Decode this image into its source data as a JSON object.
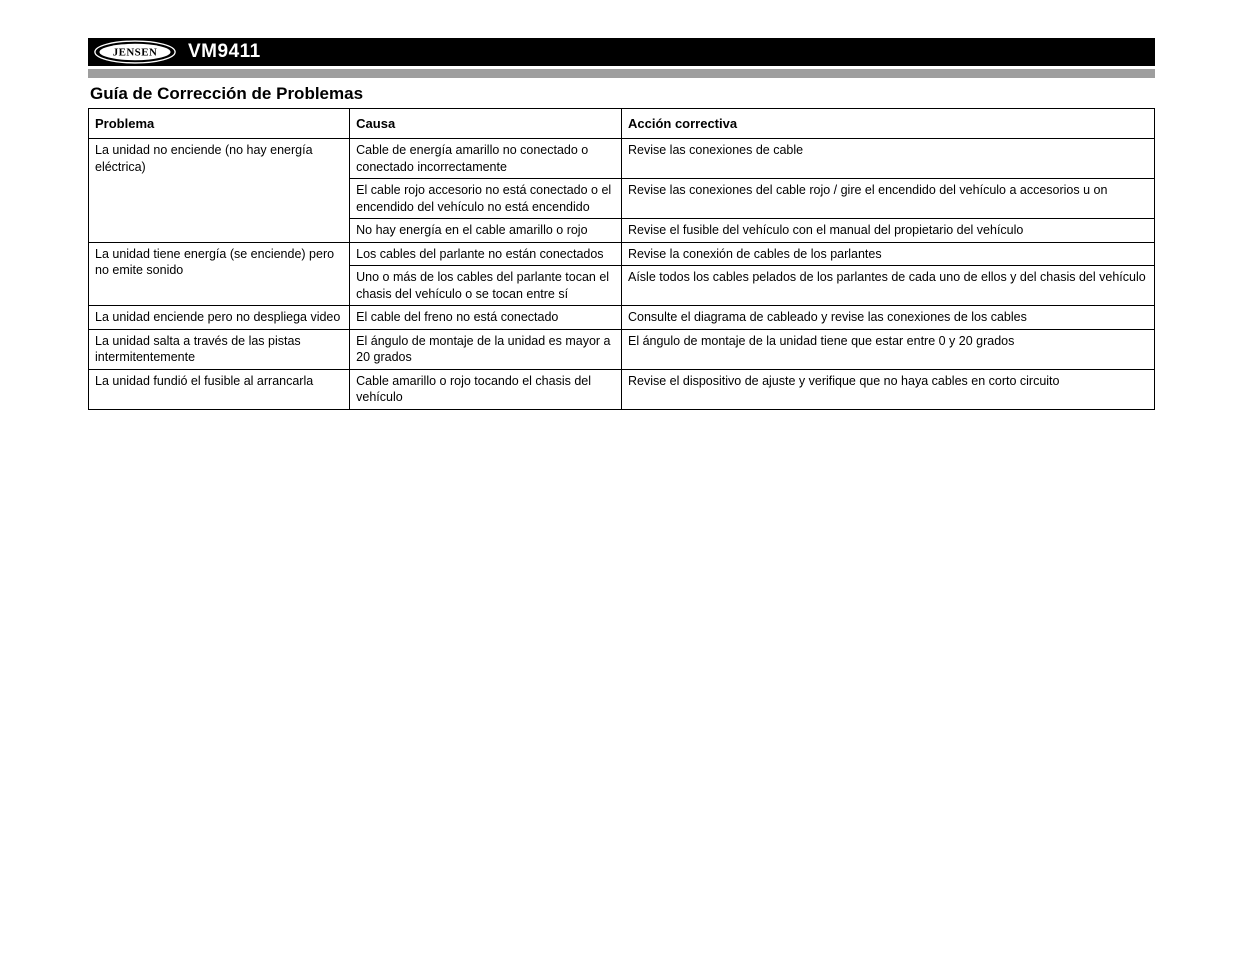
{
  "header": {
    "brand": "JENSEN",
    "model": "VM9411"
  },
  "section_title": "Guía de Corrección de Problemas",
  "columns": {
    "problem": "Problema",
    "cause": "Causa",
    "action": "Acción correctiva"
  },
  "rows": [
    {
      "problem": "La unidad no enciende (no hay energía eléctrica)",
      "entries": [
        {
          "cause": "Cable de energía amarillo no conectado o conectado incorrectamente",
          "action": "Revise las conexiones de cable"
        },
        {
          "cause": "El cable rojo accesorio no está conectado o el encendido del vehículo no está encendido",
          "action": "Revise las conexiones del cable rojo / gire el encendido del vehículo a accesorios u on"
        },
        {
          "cause": "No hay energía en el cable amarillo o rojo",
          "action": "Revise el fusible del vehículo con el manual del propietario del vehículo"
        }
      ]
    },
    {
      "problem": "La unidad tiene energía (se enciende) pero no emite sonido",
      "entries": [
        {
          "cause": "Los cables del parlante no están conectados",
          "action": "Revise la conexión de cables de los parlantes"
        },
        {
          "cause": "Uno o más de los cables del parlante tocan el chasis del vehículo o se tocan entre sí",
          "action": "Aísle todos los cables pelados de los parlantes de cada uno de ellos y del chasis del vehículo"
        }
      ]
    },
    {
      "problem": "La unidad enciende pero no despliega video",
      "entries": [
        {
          "cause": "El cable del freno no está conectado",
          "action": "Consulte el diagrama de cableado y revise las conexiones de los cables"
        }
      ]
    },
    {
      "problem": "La unidad salta a través de las pistas intermitentemente",
      "entries": [
        {
          "cause": "El ángulo de montaje de la unidad es mayor a 20 grados",
          "action": "El ángulo de montaje de la unidad tiene que estar entre 0 y 20 grados"
        }
      ]
    },
    {
      "problem": "La unidad fundió el fusible al arrancarla",
      "entries": [
        {
          "cause": "Cable amarillo o rojo tocando el chasis del vehículo",
          "action": "Revise el dispositivo de ajuste y verifique que no haya cables en corto circuito"
        }
      ]
    }
  ]
}
